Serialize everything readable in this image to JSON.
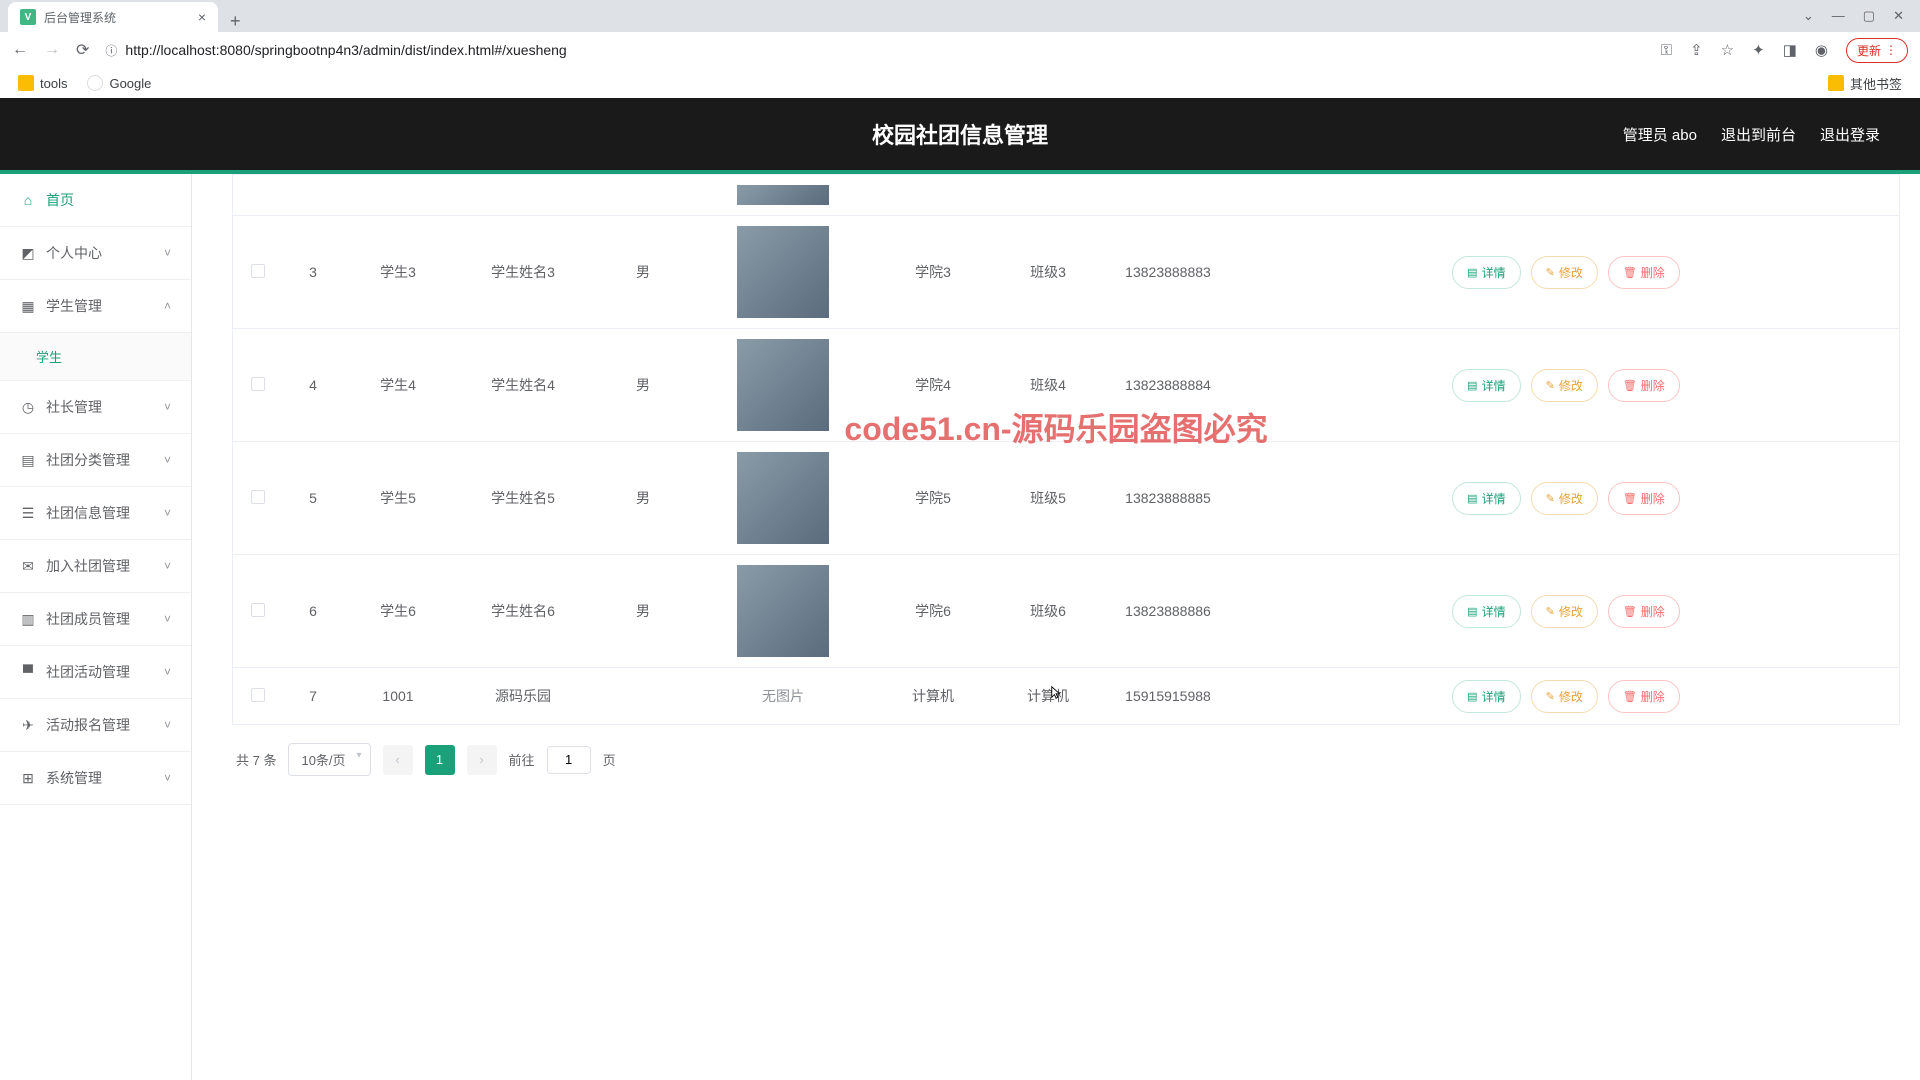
{
  "browser": {
    "tab_title": "后台管理系统",
    "url": "http://localhost:8080/springbootnp4n3/admin/dist/index.html#/xuesheng",
    "bookmarks": {
      "tools": "tools",
      "google": "Google",
      "other": "其他书签"
    },
    "update": "更新"
  },
  "header": {
    "title": "校园社团信息管理",
    "admin": "管理员 abo",
    "to_front": "退出到前台",
    "logout": "退出登录"
  },
  "sidebar": {
    "home": "首页",
    "items": [
      {
        "label": "个人中心",
        "icon": "user"
      },
      {
        "label": "学生管理",
        "icon": "grid",
        "open": true,
        "sub": [
          {
            "label": "学生"
          }
        ]
      },
      {
        "label": "社长管理",
        "icon": "compass"
      },
      {
        "label": "社团分类管理",
        "icon": "category"
      },
      {
        "label": "社团信息管理",
        "icon": "list"
      },
      {
        "label": "加入社团管理",
        "icon": "mail"
      },
      {
        "label": "社团成员管理",
        "icon": "members"
      },
      {
        "label": "社团活动管理",
        "icon": "activity"
      },
      {
        "label": "活动报名管理",
        "icon": "signup"
      },
      {
        "label": "系统管理",
        "icon": "system"
      }
    ]
  },
  "table": {
    "rows": [
      {
        "idx": "3",
        "account": "学生3",
        "name": "学生姓名3",
        "sex": "男",
        "photo": true,
        "college": "学院3",
        "class": "班级3",
        "phone": "13823888883"
      },
      {
        "idx": "4",
        "account": "学生4",
        "name": "学生姓名4",
        "sex": "男",
        "photo": true,
        "college": "学院4",
        "class": "班级4",
        "phone": "13823888884"
      },
      {
        "idx": "5",
        "account": "学生5",
        "name": "学生姓名5",
        "sex": "男",
        "photo": true,
        "college": "学院5",
        "class": "班级5",
        "phone": "13823888885"
      },
      {
        "idx": "6",
        "account": "学生6",
        "name": "学生姓名6",
        "sex": "男",
        "photo": true,
        "college": "学院6",
        "class": "班级6",
        "phone": "13823888886"
      },
      {
        "idx": "7",
        "account": "1001",
        "name": "源码乐园",
        "sex": "",
        "photo": false,
        "no_photo_text": "无图片",
        "college": "计算机",
        "class": "计算机",
        "phone": "15915915988"
      }
    ],
    "ops": {
      "detail": "详情",
      "edit": "修改",
      "delete": "删除"
    }
  },
  "pagination": {
    "total": "共 7 条",
    "page_size": "10条/页",
    "current": "1",
    "goto_prefix": "前往",
    "goto_value": "1",
    "goto_suffix": "页"
  },
  "watermark": "code51.cn-源码乐园盗图必究"
}
